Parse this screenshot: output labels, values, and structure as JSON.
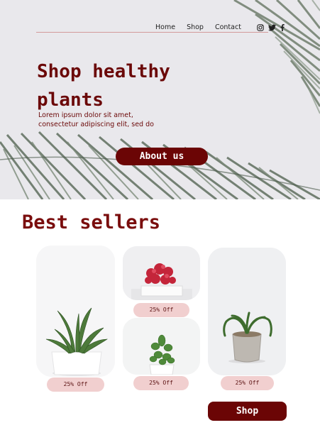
{
  "nav": {
    "links": [
      "Home",
      "Shop",
      "Contact"
    ],
    "social_icons": [
      "instagram-icon",
      "twitter-icon",
      "facebook-icon"
    ]
  },
  "hero": {
    "title": "Shop healthy plants",
    "subtitle": "Lorem ipsum dolor sit amet, consectetur adipiscing elit, sed do",
    "cta_label": "About us"
  },
  "best_sellers": {
    "title": "Best sellers",
    "products": [
      {
        "badge": "25% Off",
        "plant": "aloe in white pot"
      },
      {
        "badge": "25% Off",
        "plant": "red succulent in white pot"
      },
      {
        "badge": "25% Off",
        "plant": "jade plant in white pot"
      },
      {
        "badge": "25% Off",
        "plant": "spider plant in concrete pot"
      }
    ],
    "shop_label": "Shop"
  },
  "colors": {
    "brand": "#6b0505",
    "badge_bg": "#f1cfcf",
    "hero_bg": "#e9e8ec"
  }
}
